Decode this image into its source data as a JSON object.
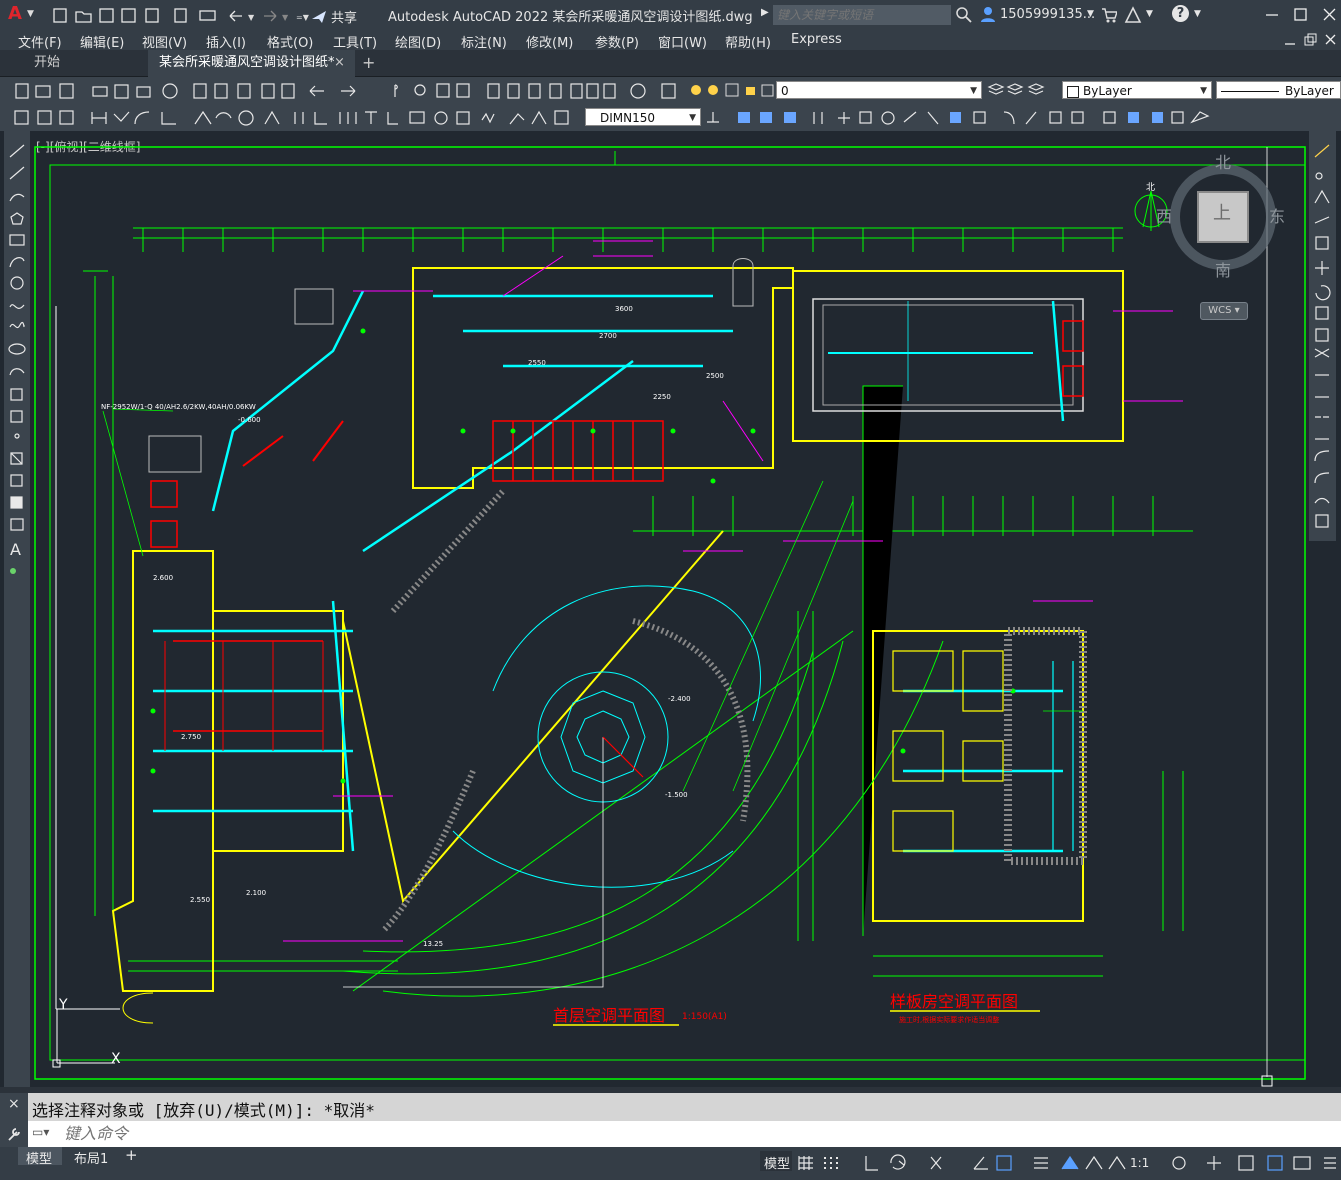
{
  "app": {
    "logo": "A",
    "share_label": "共享",
    "title": "Autodesk AutoCAD 2022    某会所采暖通风空调设计图纸.dwg",
    "search_placeholder": "键入关键字或短语",
    "user": "1505999135...",
    "help": "?"
  },
  "menu": [
    "文件(F)",
    "编辑(E)",
    "视图(V)",
    "插入(I)",
    "格式(O)",
    "工具(T)",
    "绘图(D)",
    "标注(N)",
    "修改(M)",
    "参数(P)",
    "窗口(W)",
    "帮助(H)",
    "Express"
  ],
  "tabs": [
    {
      "label": "开始",
      "active": false
    },
    {
      "label": "某会所采暖通风空调设计图纸*",
      "active": true
    }
  ],
  "ribbon": {
    "layer_value": "0",
    "color_value": "ByLayer",
    "linetype_value": "ByLayer",
    "dimstyle_value": "DIMN150"
  },
  "viewport": {
    "label": "[-][俯视][二维线框]",
    "viewcube": {
      "north": "北",
      "south": "南",
      "east": "东",
      "west": "西",
      "top": "上",
      "wcs": "WCS",
      "compass_n": "北"
    },
    "ucs": {
      "y": "Y",
      "x": "X"
    }
  },
  "drawing": {
    "title_main": "首层空调平面图",
    "scale_main": "1:150(A1)",
    "title_sample": "样板房空调平面图",
    "note_sample": "施工时,根据实际要求作适当调整",
    "notes": [
      "NF-2952W/1-Q  40/AH2.6/2KW,40AH/0.06KW",
      "-0.600",
      "2.600",
      "2.750",
      "2.100",
      "2.550",
      "13.25",
      "-1.500",
      "-2.400",
      "2550",
      "2700",
      "3600",
      "2500",
      "2250"
    ],
    "colors": {
      "green": "#00ff00",
      "yellow": "#ffff00",
      "cyan": "#00ffff",
      "red": "#ff0000",
      "magenta": "#ff00ff",
      "white": "#ffffff",
      "orange": "#ff8000"
    }
  },
  "command": {
    "history": "选择注释对象或 [放弃(U)/模式(M)]: *取消*",
    "input_placeholder": "键入命令"
  },
  "status": {
    "layout_tabs": [
      "模型",
      "布局1"
    ],
    "model_label": "模型",
    "scale": "1:1"
  },
  "window_buttons": [
    "minimize-icon",
    "maximize-icon",
    "close-icon"
  ]
}
